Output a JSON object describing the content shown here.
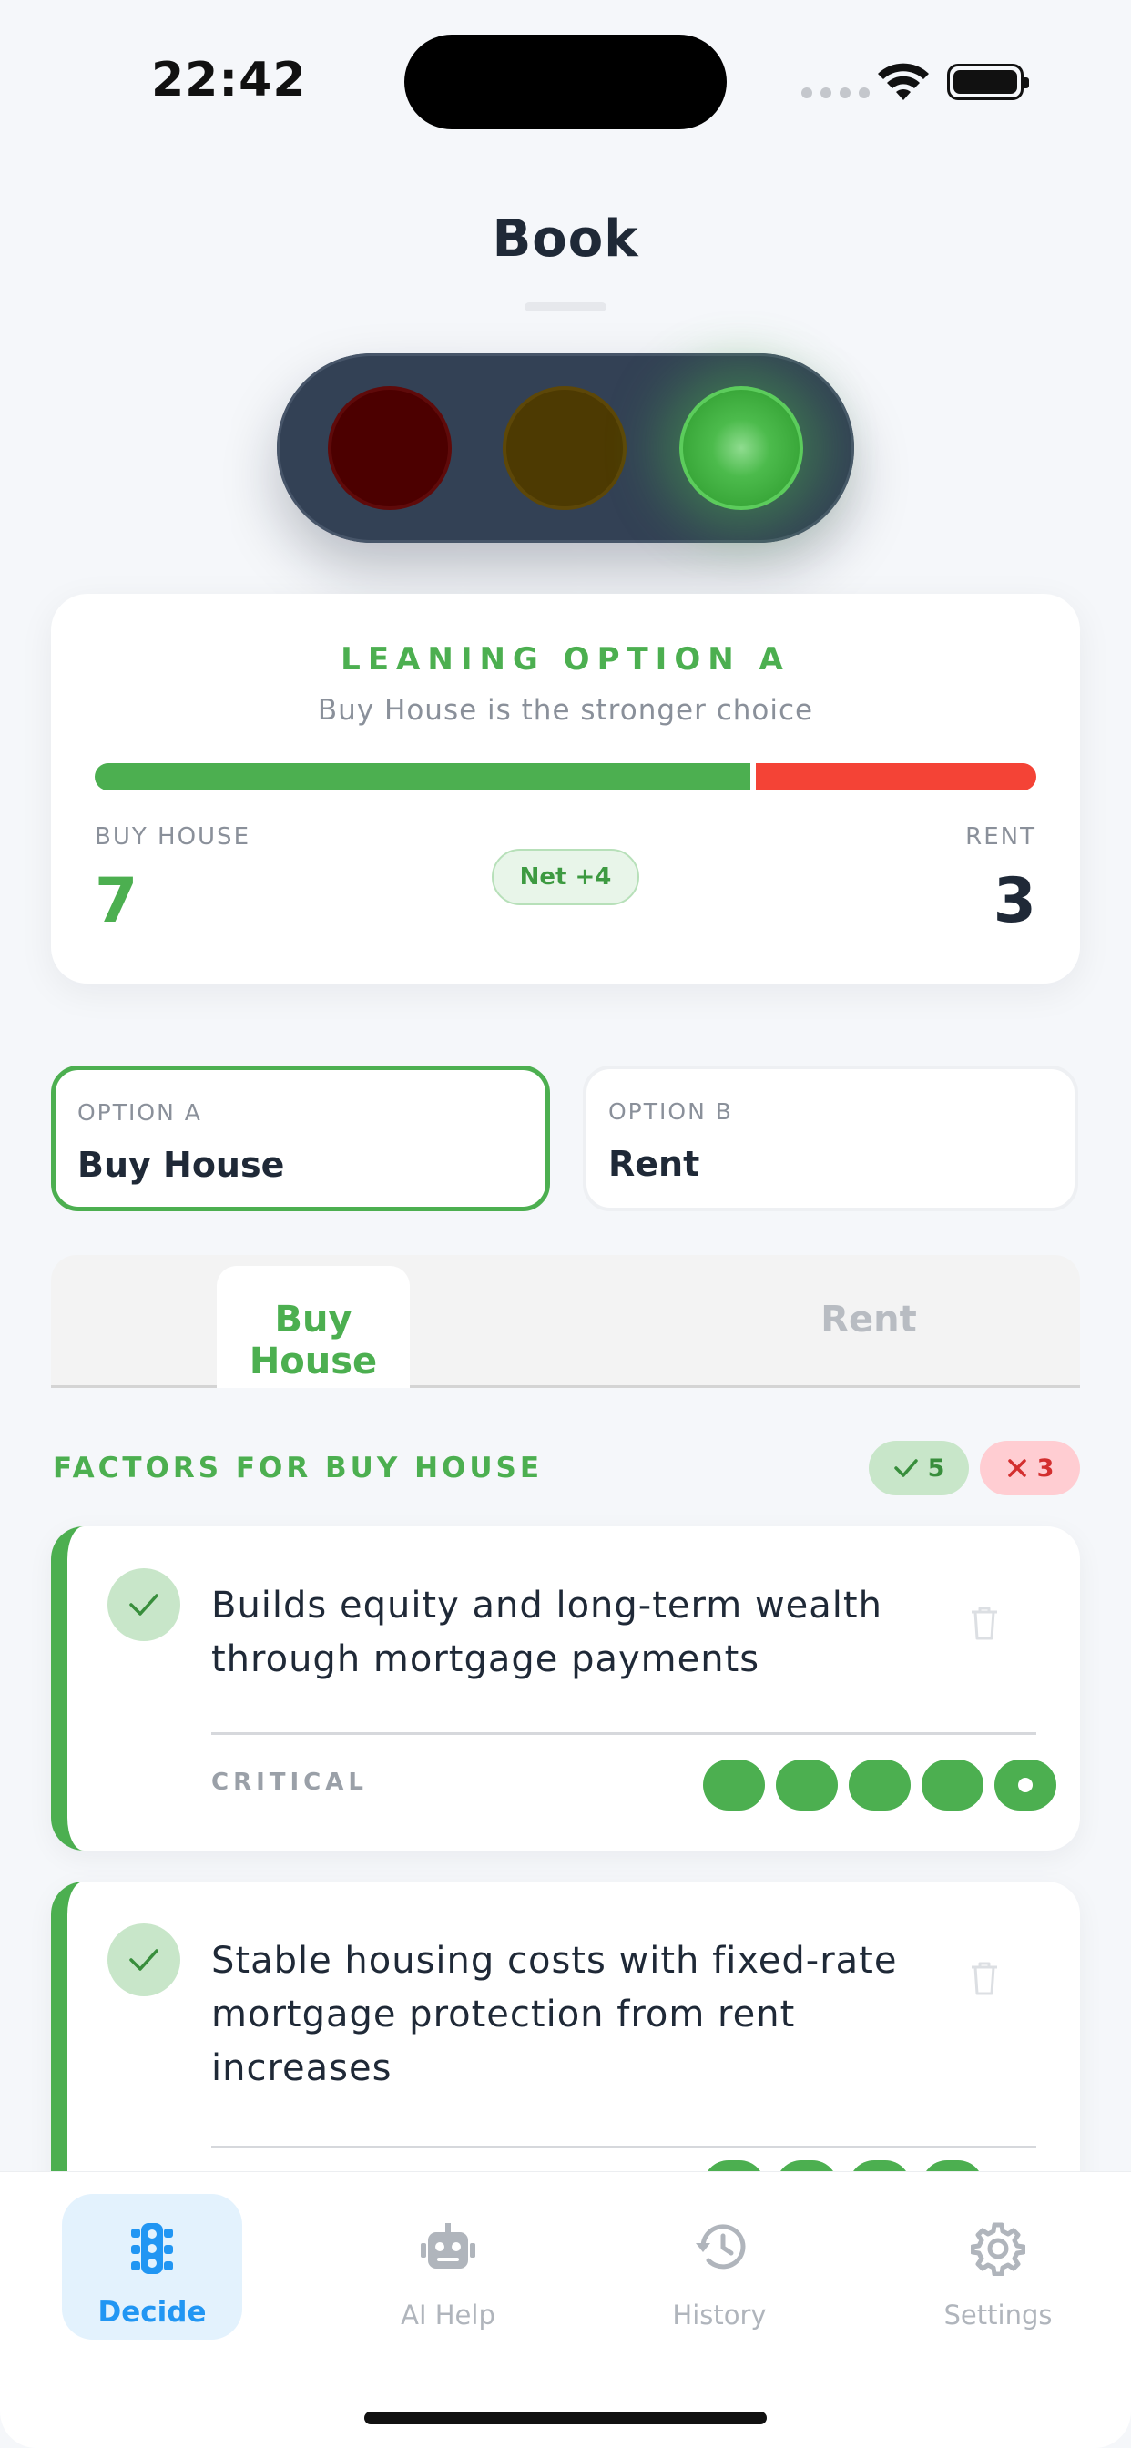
{
  "status_bar": {
    "time": "22:42"
  },
  "header": {
    "title": "Book"
  },
  "traffic_light": {
    "active": "green"
  },
  "summary": {
    "verdict": "LEANING OPTION A",
    "subtitle": "Buy House is the stronger choice",
    "option_a_label": "BUY HOUSE",
    "option_b_label": "RENT",
    "score_a": "7",
    "score_b": "3",
    "net": "Net +4",
    "share_a": 0.7
  },
  "options": {
    "a": {
      "caption": "OPTION A",
      "name": "Buy House"
    },
    "b": {
      "caption": "OPTION B",
      "name": "Rent"
    }
  },
  "tabs": [
    {
      "label": "Buy House",
      "active": true
    },
    {
      "label": "Rent",
      "active": false
    }
  ],
  "factors": {
    "title": "FACTORS FOR BUY HOUSE",
    "pro_count": "5",
    "con_count": "3",
    "items": [
      {
        "text": "Builds equity and long-term wealth through mortgage payments",
        "weight_label": "CRITICAL",
        "weight": 5
      },
      {
        "text": "Stable housing costs with fixed-rate mortgage protection from rent increases",
        "weight_label": "",
        "weight": 4
      }
    ]
  },
  "colors": {
    "accent_green": "#4caf50",
    "accent_red": "#f44336",
    "nav_active": "#2196f3"
  },
  "nav": [
    {
      "label": "Decide",
      "icon": "traffic-light-icon",
      "active": true
    },
    {
      "label": "AI Help",
      "icon": "robot-icon",
      "active": false
    },
    {
      "label": "History",
      "icon": "history-icon",
      "active": false
    },
    {
      "label": "Settings",
      "icon": "gear-icon",
      "active": false
    }
  ]
}
